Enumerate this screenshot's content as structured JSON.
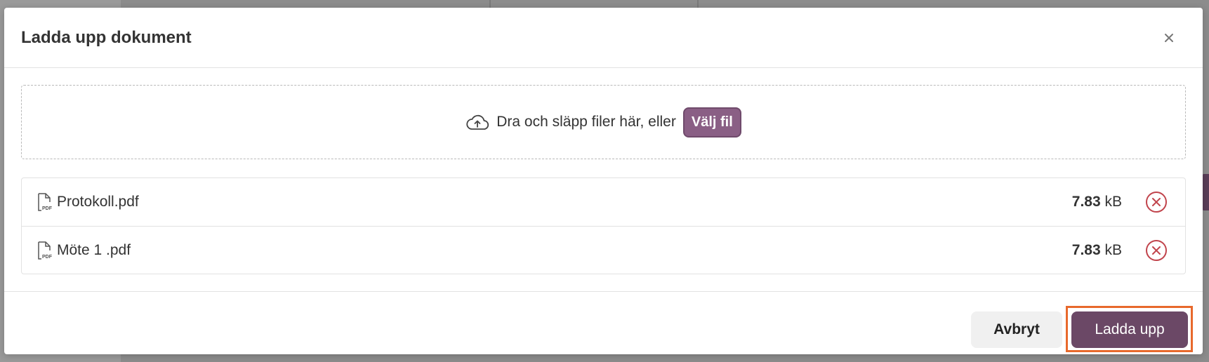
{
  "dialog": {
    "title": "Ladda upp dokument",
    "close_icon": "close-icon"
  },
  "dropzone": {
    "icon": "cloud-upload-icon",
    "text": "Dra och släpp filer här, eller",
    "choose_label": "Välj fil"
  },
  "files": [
    {
      "name": "Protokoll.pdf",
      "size_value": "7.83",
      "size_unit": "kB",
      "icon": "pdf-file-icon",
      "remove_icon": "remove-circle-icon"
    },
    {
      "name": "Möte 1 .pdf",
      "size_value": "7.83",
      "size_unit": "kB",
      "icon": "pdf-file-icon",
      "remove_icon": "remove-circle-icon"
    }
  ],
  "footer": {
    "cancel_label": "Avbryt",
    "upload_label": "Ladda upp"
  },
  "colors": {
    "primary": "#6b4866",
    "choose_button": "#8a5f85",
    "remove": "#c1444c",
    "highlight": "#e8692c"
  }
}
